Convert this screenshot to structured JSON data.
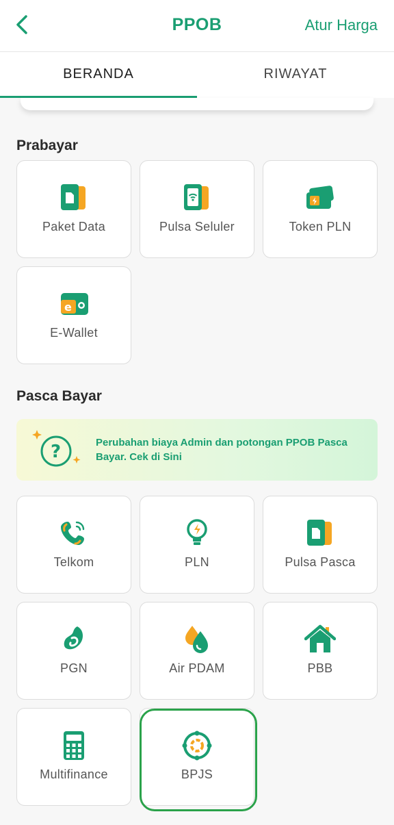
{
  "header": {
    "title": "PPOB",
    "right_action": "Atur Harga"
  },
  "tabs": [
    {
      "label": "BERANDA",
      "active": true
    },
    {
      "label": "RIWAYAT",
      "active": false
    }
  ],
  "prabayar": {
    "title": "Prabayar",
    "items": [
      {
        "label": "Paket Data",
        "icon": "sim-card-icon"
      },
      {
        "label": "Pulsa Seluler",
        "icon": "phone-signal-icon"
      },
      {
        "label": "Token PLN",
        "icon": "electric-card-icon"
      },
      {
        "label": "E-Wallet",
        "icon": "wallet-icon"
      }
    ]
  },
  "pasca": {
    "title": "Pasca Bayar",
    "banner_text": "Perubahan biaya Admin dan potongan PPOB Pasca Bayar. Cek di Sini",
    "items": [
      {
        "label": "Telkom",
        "icon": "telephone-icon"
      },
      {
        "label": "PLN",
        "icon": "light-bulb-icon"
      },
      {
        "label": "Pulsa Pasca",
        "icon": "sim-card-icon"
      },
      {
        "label": "PGN",
        "icon": "gas-flame-icon"
      },
      {
        "label": "Air PDAM",
        "icon": "water-drop-icon"
      },
      {
        "label": "PBB",
        "icon": "house-icon"
      },
      {
        "label": "Multifinance",
        "icon": "calculator-icon"
      },
      {
        "label": "BPJS",
        "icon": "bpjs-logo-icon"
      }
    ]
  },
  "colors": {
    "brand": "#1a9e72",
    "accent": "#f5a623",
    "highlight": "#2aa24a"
  }
}
